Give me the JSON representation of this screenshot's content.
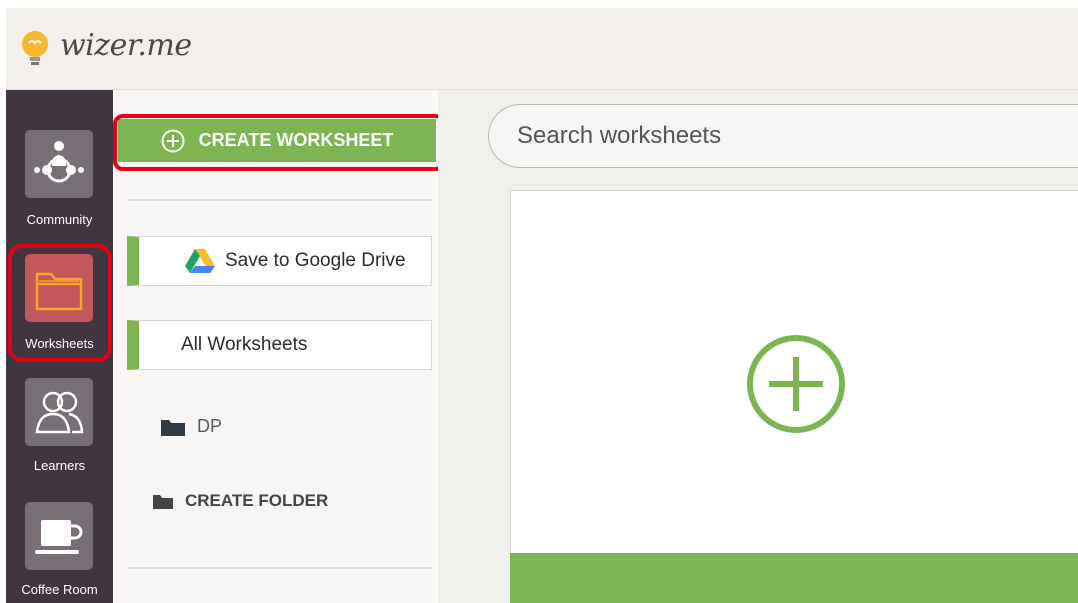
{
  "app": {
    "logo_text": "wizer.me"
  },
  "sidebar": {
    "items": [
      {
        "label": "Community",
        "icon": "community-icon"
      },
      {
        "label": "Worksheets",
        "icon": "folder-icon"
      },
      {
        "label": "Learners",
        "icon": "learners-icon"
      },
      {
        "label": "Coffee Room",
        "icon": "coffee-cup-icon"
      }
    ]
  },
  "panel": {
    "create_label": "CREATE WORKSHEET",
    "save_drive_label": "Save to Google Drive",
    "all_worksheets_label": "All Worksheets",
    "folders": [
      {
        "name": "DP"
      }
    ],
    "create_folder_label": "CREATE FOLDER"
  },
  "search": {
    "placeholder": "Search worksheets"
  },
  "colors": {
    "accent_green": "#7db552",
    "sidebar_bg": "#41353f",
    "active_tile": "#c3575b",
    "highlight_red": "#e50012"
  }
}
